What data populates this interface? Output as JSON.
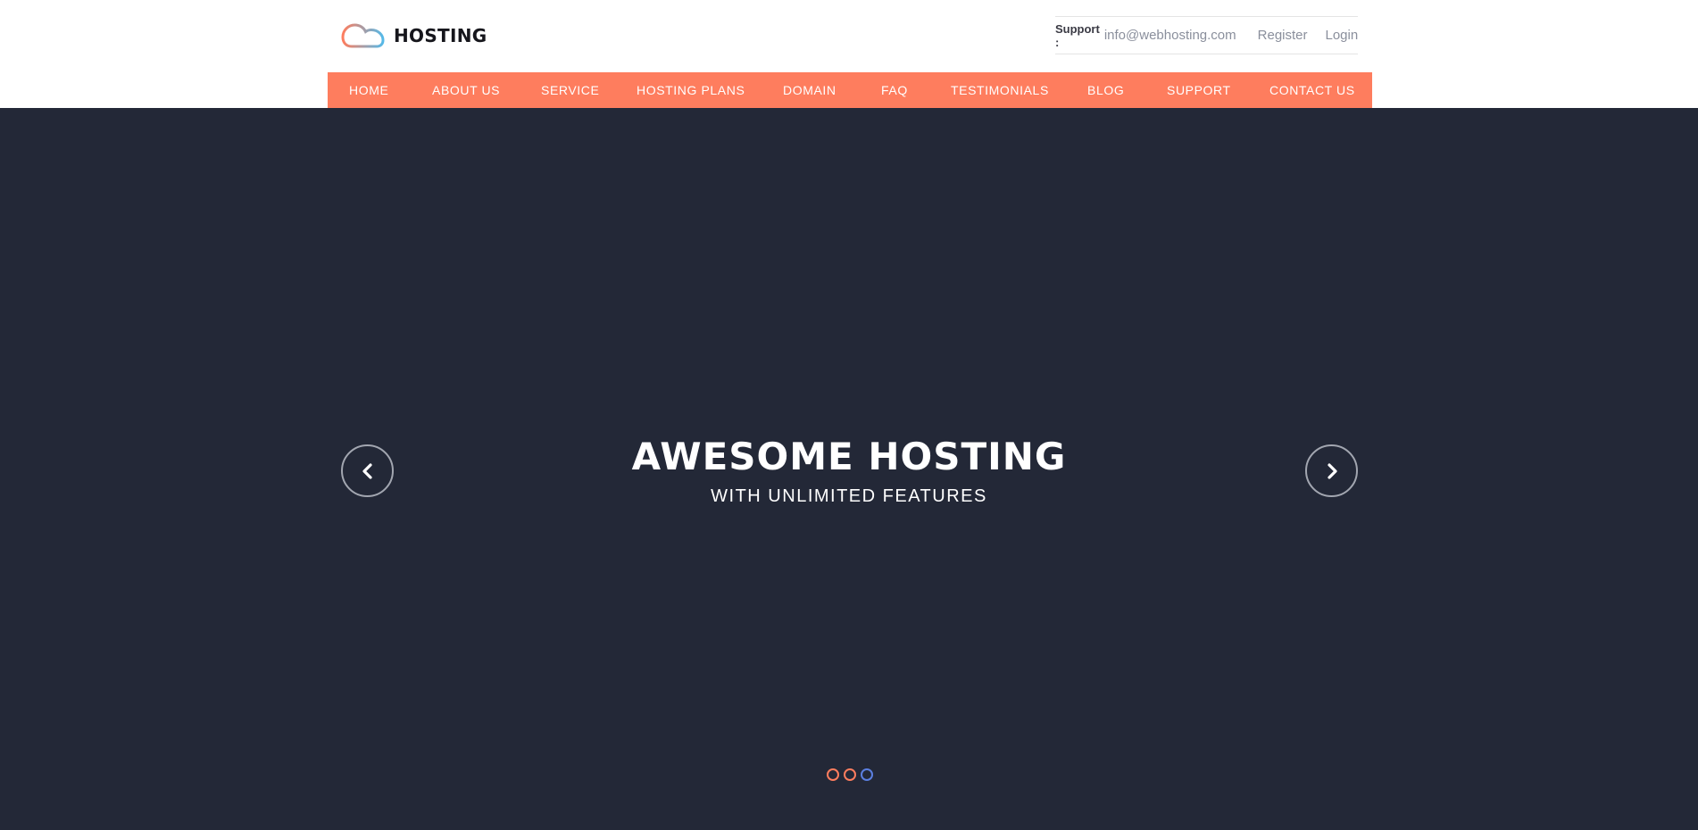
{
  "brand": {
    "name": "HOSTING",
    "logo_icon": "cloud-icon",
    "colors": {
      "accent": "#fe7d5e",
      "secondary": "#55b9e8",
      "hero_bg": "#232837"
    }
  },
  "topbar": {
    "support_label": "Support :",
    "support_email": "info@webhosting.com",
    "register_label": "Register",
    "login_label": "Login"
  },
  "nav": {
    "items": [
      {
        "label": "HOME"
      },
      {
        "label": "ABOUT US"
      },
      {
        "label": "SERVICE"
      },
      {
        "label": "HOSTING PLANS"
      },
      {
        "label": "DOMAIN"
      },
      {
        "label": "FAQ"
      },
      {
        "label": "TESTIMONIALS"
      },
      {
        "label": "BLOG"
      },
      {
        "label": "SUPPORT"
      },
      {
        "label": "CONTACT US"
      }
    ]
  },
  "hero": {
    "title": "AWESOME HOSTING",
    "subtitle": "WITH UNLIMITED FEATURES",
    "prev_icon": "chevron-left-icon",
    "next_icon": "chevron-right-icon",
    "slides_count": 3,
    "active_slide": 3
  }
}
